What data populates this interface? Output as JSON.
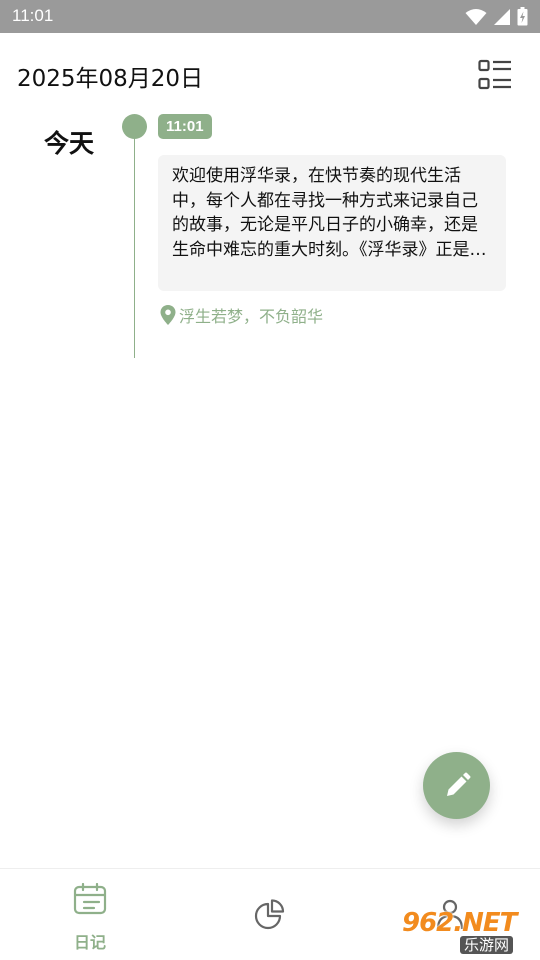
{
  "status_bar": {
    "time": "11:01"
  },
  "header": {
    "date": "2025年08月20日"
  },
  "timeline": {
    "day_label": "今天",
    "entries": [
      {
        "time": "11:01",
        "text": "欢迎使用浮华录，在快节奏的现代生活中，每个人都在寻找一种方式来记录自己的故事，无论是平凡日子的小确幸，还是生命中难忘的重大时刻。《浮华录》正是一款专为追求品质生活而设计的日记应用",
        "location": "浮生若梦，不负韶华"
      }
    ]
  },
  "bottom_nav": {
    "items": [
      {
        "label": "日记",
        "icon": "calendar-icon",
        "active": true
      },
      {
        "label": "",
        "icon": "pie-chart-icon",
        "active": false
      },
      {
        "label": "",
        "icon": "person-icon",
        "active": false
      }
    ]
  },
  "watermark": {
    "top": "962.NET",
    "bottom": "乐游网"
  },
  "colors": {
    "accent": "#8fb08a",
    "status_bar": "#9a9a9a",
    "card": "#f4f4f4"
  }
}
